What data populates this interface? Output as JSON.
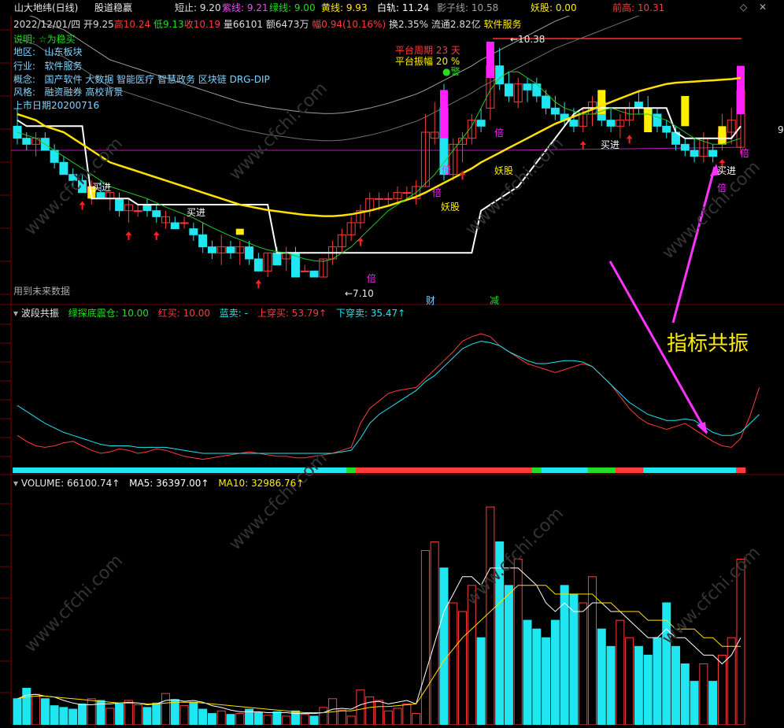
{
  "colors": {
    "up": "#ff3b3b",
    "down": "#1fe6f0",
    "ma_white": "#ffffff",
    "ma_yellow": "#ffe000",
    "ma_green": "#22cc22",
    "ma_magenta": "#b41cb4",
    "boll_gray": "#a0a0a0",
    "signal_magenta": "#ff22ff",
    "signal_yellow": "#ffee00",
    "grid": "#7a0000",
    "header_red": "#ff3b3b",
    "vol_red": "#ff3b3b",
    "vol_cyan": "#1fe6f0",
    "big_label": "#ffee00"
  },
  "header": {
    "title": "山大地纬(日线)",
    "indicator": "股道稳赢",
    "items": [
      {
        "label": "短止: 9.20",
        "color": "#e0e0e0"
      },
      {
        "label": "紫线: 9.21",
        "color": "#ff44ff"
      },
      {
        "label": "绿线: 9.00",
        "color": "#22dd22"
      },
      {
        "label": "黄线: 9.93",
        "color": "#ffee00"
      },
      {
        "label": "白轨: 11.24",
        "color": "#ffffff"
      },
      {
        "label": "影子线: 10.58",
        "color": "#a0a0a0"
      },
      {
        "label": "妖股: 0.00",
        "color": "#ffee00"
      },
      {
        "label": "前高: 10.31",
        "color": "#ff3b3b"
      }
    ],
    "quote_date": "2022/12/01/四",
    "quote_open": "开9.25",
    "quote_high": "高10.24",
    "quote_low": "低9.13",
    "quote_close": "收10.19",
    "quote_vol": "量66101",
    "quote_amt": "额6473万",
    "quote_pct": "幅0.94(10.16%)",
    "quote_turn": "换2.35%",
    "quote_float": "流通2.82亿",
    "quote_sector": "软件服务"
  },
  "info": {
    "note": "说明: ☆为稳买",
    "region_label": "地区:",
    "region": "山东板块",
    "industry_label": "行业:",
    "industry": "软件服务",
    "concept_label": "概念:",
    "concept": "国产软件 大数据 智能医疗 智慧政务 区块链 DRG-DIP",
    "style_label": "风格:",
    "style": "融资融券 高校背景",
    "listing": "上市日期20200716",
    "future_data": "用到未来数据"
  },
  "annotations": {
    "platform_period": "平台周期 23 天",
    "platform_amp": "平台振幅 20 %",
    "warn": "●警",
    "high_label": "←10.38",
    "low_label": "←7.10",
    "buy": "买进",
    "bei": "倍",
    "yao": "妖股",
    "cai": "财",
    "jian": "减",
    "big_text": "指标共振",
    "right_edge": "9"
  },
  "osc": {
    "title": "波段共振",
    "items": [
      {
        "label": "绿探底震仓: 10.00",
        "color": "#22dd22"
      },
      {
        "label": "红买: 10.00",
        "color": "#ff3b3b"
      },
      {
        "label": "蓝卖: -",
        "color": "#1fe6f0"
      },
      {
        "label": "上穿买: 53.79↑",
        "color": "#ff3b3b"
      },
      {
        "label": "下穿卖: 35.47↑",
        "color": "#1fe6f0"
      }
    ]
  },
  "volume": {
    "title": "VOLUME: 66100.74↑",
    "items": [
      {
        "label": "MA5: 36397.00↑",
        "color": "#ffffff"
      },
      {
        "label": "MA10: 32986.76↑",
        "color": "#ffee00"
      }
    ]
  },
  "watermark": "www.cfchi.com",
  "chart_data": {
    "type": "candlestick",
    "ylim": [
      6.8,
      11.3
    ],
    "candles": [
      [
        9.6,
        9.9,
        9.3,
        9.4
      ],
      [
        9.4,
        9.5,
        9.2,
        9.3
      ],
      [
        9.3,
        9.5,
        9.1,
        9.4
      ],
      [
        9.4,
        9.5,
        9.2,
        9.2
      ],
      [
        9.2,
        9.3,
        8.9,
        9.0
      ],
      [
        9.0,
        9.1,
        8.8,
        8.8
      ],
      [
        8.8,
        8.9,
        8.6,
        8.7
      ],
      [
        8.7,
        8.8,
        8.5,
        8.5
      ],
      [
        8.5,
        8.7,
        8.3,
        8.6
      ],
      [
        8.5,
        8.7,
        8.4,
        8.4
      ],
      [
        8.4,
        8.5,
        8.2,
        8.5
      ],
      [
        8.4,
        8.5,
        8.1,
        8.2
      ],
      [
        8.2,
        8.4,
        8.0,
        8.3
      ],
      [
        8.2,
        8.3,
        8.1,
        8.2
      ],
      [
        8.3,
        8.4,
        8.1,
        8.2
      ],
      [
        8.2,
        8.3,
        8.0,
        8.1
      ],
      [
        8.0,
        8.2,
        7.9,
        8.1
      ],
      [
        8.0,
        8.1,
        7.9,
        7.9
      ],
      [
        8.0,
        8.1,
        7.9,
        8.0
      ],
      [
        7.9,
        8.0,
        7.7,
        7.8
      ],
      [
        7.8,
        8.0,
        7.5,
        7.6
      ],
      [
        7.6,
        7.7,
        7.4,
        7.5
      ],
      [
        7.5,
        7.8,
        7.3,
        7.6
      ],
      [
        7.6,
        7.7,
        7.4,
        7.5
      ],
      [
        7.5,
        7.7,
        7.3,
        7.6
      ],
      [
        7.6,
        7.7,
        7.3,
        7.4
      ],
      [
        7.4,
        7.5,
        7.2,
        7.2
      ],
      [
        7.2,
        7.5,
        7.1,
        7.5
      ],
      [
        7.5,
        7.6,
        7.3,
        7.3
      ],
      [
        7.4,
        7.6,
        7.2,
        7.5
      ],
      [
        7.5,
        7.6,
        7.1,
        7.1
      ],
      [
        7.2,
        7.3,
        7.2,
        7.2
      ],
      [
        7.2,
        7.2,
        7.1,
        7.1
      ],
      [
        7.1,
        7.4,
        7.1,
        7.4
      ],
      [
        7.4,
        7.7,
        7.3,
        7.6
      ],
      [
        7.6,
        7.9,
        7.5,
        7.8
      ],
      [
        7.8,
        8.1,
        7.7,
        8.0
      ],
      [
        8.0,
        8.3,
        7.9,
        8.2
      ],
      [
        8.2,
        8.5,
        8.1,
        8.4
      ],
      [
        8.4,
        8.5,
        8.2,
        8.4
      ],
      [
        8.4,
        8.5,
        8.3,
        8.4
      ],
      [
        8.4,
        8.6,
        8.3,
        8.5
      ],
      [
        8.5,
        8.6,
        8.4,
        8.5
      ],
      [
        8.4,
        8.7,
        8.3,
        8.6
      ],
      [
        8.6,
        9.8,
        8.6,
        9.5
      ],
      [
        9.4,
        10.0,
        9.3,
        9.5
      ],
      [
        9.9,
        10.3,
        8.7,
        8.8
      ],
      [
        8.8,
        9.4,
        8.7,
        9.3
      ],
      [
        9.3,
        9.5,
        9.0,
        9.4
      ],
      [
        9.4,
        9.8,
        9.3,
        9.7
      ],
      [
        9.7,
        9.9,
        9.5,
        9.6
      ],
      [
        9.9,
        10.6,
        9.7,
        10.6
      ],
      [
        10.6,
        10.9,
        10.2,
        10.3
      ],
      [
        10.3,
        10.5,
        10.0,
        10.1
      ],
      [
        10.0,
        10.4,
        9.9,
        10.3
      ],
      [
        10.3,
        10.4,
        10.0,
        10.2
      ],
      [
        10.3,
        10.4,
        10.0,
        10.1
      ],
      [
        10.1,
        10.2,
        9.8,
        9.9
      ],
      [
        9.9,
        10.1,
        9.7,
        9.8
      ],
      [
        9.8,
        10.0,
        9.6,
        9.7
      ],
      [
        9.7,
        9.9,
        9.5,
        9.6
      ],
      [
        9.6,
        9.9,
        9.5,
        9.8
      ],
      [
        9.8,
        10.1,
        9.6,
        10.0
      ],
      [
        10.0,
        10.1,
        9.6,
        9.7
      ],
      [
        9.7,
        9.9,
        9.5,
        9.6
      ],
      [
        9.6,
        9.8,
        9.4,
        9.7
      ],
      [
        9.7,
        10.0,
        9.6,
        9.9
      ],
      [
        10.0,
        10.2,
        9.8,
        9.9
      ],
      [
        9.9,
        10.1,
        9.7,
        9.8
      ],
      [
        9.8,
        9.9,
        9.5,
        9.6
      ],
      [
        9.6,
        9.7,
        9.4,
        9.5
      ],
      [
        9.5,
        9.6,
        9.2,
        9.3
      ],
      [
        9.3,
        9.4,
        9.1,
        9.2
      ],
      [
        9.2,
        9.4,
        9.0,
        9.1
      ],
      [
        9.1,
        9.5,
        9.0,
        9.4
      ],
      [
        9.2,
        9.3,
        9.0,
        9.1
      ],
      [
        9.3,
        9.8,
        9.2,
        9.5
      ],
      [
        9.5,
        9.9,
        9.3,
        9.7
      ],
      [
        9.25,
        10.24,
        9.13,
        10.19
      ]
    ],
    "ma_white": [
      9.7,
      9.6,
      9.6,
      9.6,
      9.6,
      9.6,
      9.6,
      9.6,
      8.4,
      8.4,
      8.4,
      8.4,
      8.4,
      8.3,
      8.3,
      8.3,
      8.3,
      8.3,
      8.3,
      8.3,
      8.3,
      8.3,
      8.3,
      8.3,
      8.3,
      8.3,
      8.3,
      8.3,
      7.5,
      7.5,
      7.5,
      7.5,
      7.5,
      7.5,
      7.5,
      7.5,
      7.5,
      7.5,
      7.5,
      7.5,
      7.5,
      7.5,
      7.5,
      7.5,
      7.5,
      7.5,
      7.5,
      7.5,
      7.5,
      7.5,
      8.2,
      8.3,
      8.4,
      8.5,
      8.6,
      8.8,
      9.0,
      9.2,
      9.4,
      9.6,
      9.8,
      9.9,
      9.9,
      9.9,
      9.9,
      9.9,
      9.9,
      9.9,
      9.9,
      9.9,
      9.9,
      9.5,
      9.4,
      9.4,
      9.4,
      9.4,
      9.4,
      9.4,
      9.6
    ],
    "ma_yellow": [
      9.8,
      9.75,
      9.7,
      9.6,
      9.55,
      9.5,
      9.4,
      9.3,
      9.2,
      9.1,
      9.0,
      8.95,
      8.9,
      8.85,
      8.8,
      8.75,
      8.7,
      8.65,
      8.6,
      8.55,
      8.5,
      8.45,
      8.4,
      8.35,
      8.3,
      8.27,
      8.24,
      8.21,
      8.19,
      8.17,
      8.15,
      8.13,
      8.12,
      8.11,
      8.11,
      8.12,
      8.14,
      8.17,
      8.2,
      8.24,
      8.28,
      8.33,
      8.38,
      8.43,
      8.5,
      8.58,
      8.66,
      8.74,
      8.82,
      8.9,
      9.0,
      9.08,
      9.16,
      9.24,
      9.32,
      9.4,
      9.48,
      9.56,
      9.64,
      9.7,
      9.76,
      9.82,
      9.88,
      9.94,
      10.0,
      10.06,
      10.12,
      10.18,
      10.22,
      10.26,
      10.3,
      10.32,
      10.33,
      10.34,
      10.35,
      10.36,
      10.37,
      10.38,
      10.4
    ],
    "ma_green": [
      9.5,
      9.45,
      9.4,
      9.3,
      9.2,
      9.1,
      9.0,
      8.9,
      8.8,
      8.7,
      8.6,
      8.55,
      8.5,
      8.45,
      8.4,
      8.33,
      8.26,
      8.2,
      8.14,
      8.08,
      8.0,
      7.92,
      7.85,
      7.78,
      7.72,
      7.66,
      7.6,
      7.55,
      7.52,
      7.5,
      7.45,
      7.4,
      7.37,
      7.36,
      7.4,
      7.5,
      7.6,
      7.75,
      7.9,
      8.05,
      8.2,
      8.3,
      8.4,
      8.5,
      8.65,
      8.8,
      9.0,
      9.2,
      9.4,
      9.6,
      9.9,
      10.2,
      10.4,
      10.5,
      10.5,
      10.4,
      10.3,
      10.15,
      10.0,
      9.9,
      9.85,
      9.8,
      9.8,
      9.85,
      9.9,
      9.85,
      9.8,
      9.8,
      9.8,
      9.75,
      9.7,
      9.6,
      9.5,
      9.4,
      9.35,
      9.3,
      9.3,
      9.35,
      9.4
    ],
    "osc_red": [
      22,
      18,
      15,
      14,
      15,
      17,
      18,
      15,
      12,
      10,
      11,
      13,
      12,
      10,
      11,
      13,
      12,
      10,
      8,
      7,
      6,
      7,
      8,
      9,
      10,
      11,
      10,
      9,
      8,
      8,
      7,
      7,
      8,
      9,
      10,
      12,
      14,
      30,
      40,
      45,
      50,
      52,
      53,
      54,
      60,
      66,
      72,
      78,
      85,
      88,
      90,
      88,
      82,
      78,
      74,
      70,
      68,
      66,
      64,
      66,
      68,
      70,
      68,
      62,
      56,
      48,
      40,
      34,
      30,
      28,
      26,
      28,
      30,
      26,
      22,
      18,
      15,
      14,
      20,
      35,
      54
    ],
    "osc_cyan": [
      42,
      38,
      34,
      30,
      27,
      24,
      22,
      20,
      18,
      16,
      15,
      15,
      15,
      14,
      14,
      14,
      14,
      13,
      12,
      11,
      10,
      10,
      10,
      10,
      10,
      10,
      10,
      10,
      10,
      10,
      10,
      10,
      10,
      10,
      10,
      11,
      12,
      20,
      30,
      36,
      40,
      44,
      48,
      52,
      58,
      62,
      68,
      74,
      80,
      83,
      85,
      84,
      82,
      78,
      75,
      72,
      70,
      70,
      71,
      72,
      72,
      71,
      68,
      62,
      56,
      50,
      44,
      40,
      36,
      34,
      32,
      32,
      33,
      32,
      28,
      24,
      22,
      22,
      24,
      30,
      36
    ],
    "osc_bar": [
      "c",
      "c",
      "c",
      "c",
      "c",
      "c",
      "c",
      "c",
      "c",
      "c",
      "c",
      "c",
      "c",
      "c",
      "c",
      "c",
      "c",
      "c",
      "c",
      "c",
      "c",
      "c",
      "c",
      "c",
      "c",
      "c",
      "c",
      "c",
      "c",
      "c",
      "c",
      "c",
      "c",
      "c",
      "c",
      "c",
      "g",
      "r",
      "r",
      "r",
      "r",
      "r",
      "r",
      "r",
      "r",
      "r",
      "r",
      "r",
      "r",
      "r",
      "r",
      "r",
      "r",
      "r",
      "r",
      "r",
      "g",
      "c",
      "c",
      "c",
      "c",
      "c",
      "g",
      "g",
      "g",
      "r",
      "r",
      "r",
      "c",
      "c",
      "c",
      "c",
      "c",
      "c",
      "c",
      "c",
      "c",
      "c",
      "r"
    ],
    "volume": [
      3.0,
      4.2,
      3.5,
      3.0,
      2.2,
      2.0,
      1.8,
      2.4,
      3.0,
      2.8,
      1.9,
      2.4,
      2.8,
      2.3,
      2.0,
      2.5,
      3.6,
      2.9,
      2.2,
      2.6,
      1.8,
      1.3,
      1.6,
      1.2,
      1.3,
      1.8,
      1.4,
      1.1,
      1.5,
      1.0,
      1.6,
      1.2,
      1.0,
      2.0,
      3.0,
      1.7,
      1.0,
      4.0,
      3.2,
      2.8,
      1.6,
      1.9,
      2.4,
      1.3,
      20,
      21,
      18,
      14,
      13,
      16,
      10,
      25,
      21,
      16,
      19,
      12,
      11,
      10,
      12,
      16,
      15,
      14,
      17,
      11,
      9,
      12,
      10,
      9,
      8,
      10,
      14,
      9,
      7,
      5,
      7,
      5,
      8,
      10,
      19
    ],
    "vol_ma5": [
      3,
      3.4,
      3.5,
      3.3,
      3.2,
      2.8,
      2.5,
      2.3,
      2.3,
      2.4,
      2.4,
      2.5,
      2.6,
      2.5,
      2.3,
      2.4,
      2.8,
      2.9,
      2.7,
      2.8,
      2.6,
      2.2,
      2.0,
      1.7,
      1.5,
      1.5,
      1.5,
      1.4,
      1.4,
      1.4,
      1.3,
      1.3,
      1.3,
      1.4,
      1.8,
      1.9,
      1.8,
      2.3,
      2.6,
      2.7,
      2.4,
      2.6,
      2.8,
      2.4,
      5.9,
      9.4,
      13,
      15,
      17,
      17,
      16,
      18,
      18,
      18,
      18,
      17,
      16,
      14,
      13,
      14,
      13,
      13,
      14,
      14,
      13,
      13,
      12,
      11,
      10,
      10,
      11,
      10,
      10,
      9,
      8,
      8,
      7,
      8,
      10
    ],
    "vol_ma10": [
      3,
      3.2,
      3.3,
      3.3,
      3.2,
      3.1,
      3.0,
      2.9,
      2.8,
      2.7,
      2.6,
      2.5,
      2.5,
      2.5,
      2.4,
      2.4,
      2.5,
      2.6,
      2.6,
      2.6,
      2.5,
      2.4,
      2.3,
      2.2,
      2.1,
      2.0,
      1.9,
      1.8,
      1.7,
      1.6,
      1.5,
      1.4,
      1.4,
      1.4,
      1.5,
      1.6,
      1.6,
      1.8,
      2.0,
      2.1,
      2.1,
      2.2,
      2.3,
      2.4,
      4.0,
      5.7,
      7.4,
      8.7,
      10,
      11,
      12,
      13,
      14,
      15,
      16,
      16,
      16,
      16,
      15,
      15,
      15,
      15,
      15,
      14,
      14,
      13,
      13,
      13,
      12,
      12,
      12,
      11,
      11,
      11,
      10,
      10,
      9,
      9,
      9
    ]
  }
}
